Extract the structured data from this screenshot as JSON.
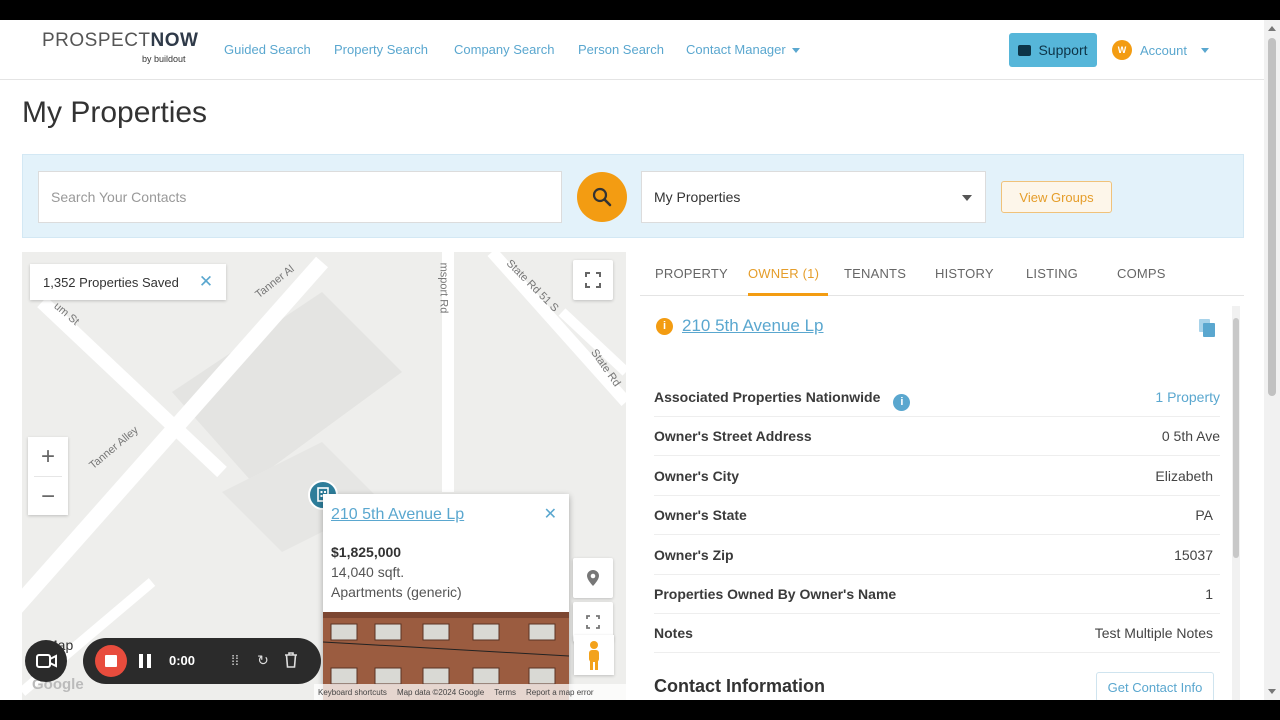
{
  "nav": {
    "logo_main_light": "PROSPECT",
    "logo_main_bold": "NOW",
    "logo_sub": "by buildout",
    "links": [
      "Guided Search",
      "Property Search",
      "Company Search",
      "Person Search",
      "Contact Manager"
    ],
    "support_label": "Support",
    "account_initial": "W",
    "account_label": "Account"
  },
  "page": {
    "title": "My Properties"
  },
  "search": {
    "placeholder": "Search Your Contacts",
    "select_value": "My Properties",
    "view_groups_label": "View Groups"
  },
  "map": {
    "saved_count_label": "1,352 Properties Saved",
    "zoom_in": "+",
    "zoom_out": "−",
    "streets": [
      "Tanner Al",
      "Tanner Alley",
      "msport Rd",
      "State Rd 51 S",
      "State Rd",
      "um St"
    ],
    "map_type_label": "Map",
    "google": "Google",
    "footer": [
      "Keyboard shortcuts",
      "Map data ©2024 Google",
      "Terms",
      "Report a map error"
    ],
    "popup": {
      "title": "210 5th Avenue Lp",
      "price": "$1,825,000",
      "sqft": "14,040 sqft.",
      "type": "Apartments (generic)"
    }
  },
  "recorder": {
    "time": "0:00"
  },
  "panel": {
    "tabs": [
      "PROPERTY",
      "OWNER (1)",
      "TENANTS",
      "HISTORY",
      "LISTING",
      "COMPS"
    ],
    "active_tab": "OWNER (1)",
    "owner_name": "210 5th Avenue Lp",
    "rows": [
      {
        "label": "Associated Properties Nationwide",
        "value": "1 Property"
      },
      {
        "label": "Owner's Street Address",
        "value": "0 5th Ave"
      },
      {
        "label": "Owner's City",
        "value": "Elizabeth"
      },
      {
        "label": "Owner's State",
        "value": "PA"
      },
      {
        "label": "Owner's Zip",
        "value": "15037"
      },
      {
        "label": "Properties Owned By Owner's Name",
        "value": "1"
      },
      {
        "label": "Notes",
        "value": "Test Multiple Notes"
      }
    ],
    "contact_heading": "Contact Information",
    "contact_button": "Get Contact Info"
  },
  "colors": {
    "accent": "#f39c12",
    "link": "#5aa7cf",
    "support": "#56b6d9",
    "record": "#e84c3d"
  },
  "icons": [
    "search-icon",
    "support-chat-icon",
    "copy-icon",
    "fullscreen-icon",
    "location-pin-icon",
    "pegman-icon",
    "camera-icon",
    "stop-icon",
    "pause-icon",
    "grid-icon",
    "restart-icon",
    "trash-icon"
  ]
}
